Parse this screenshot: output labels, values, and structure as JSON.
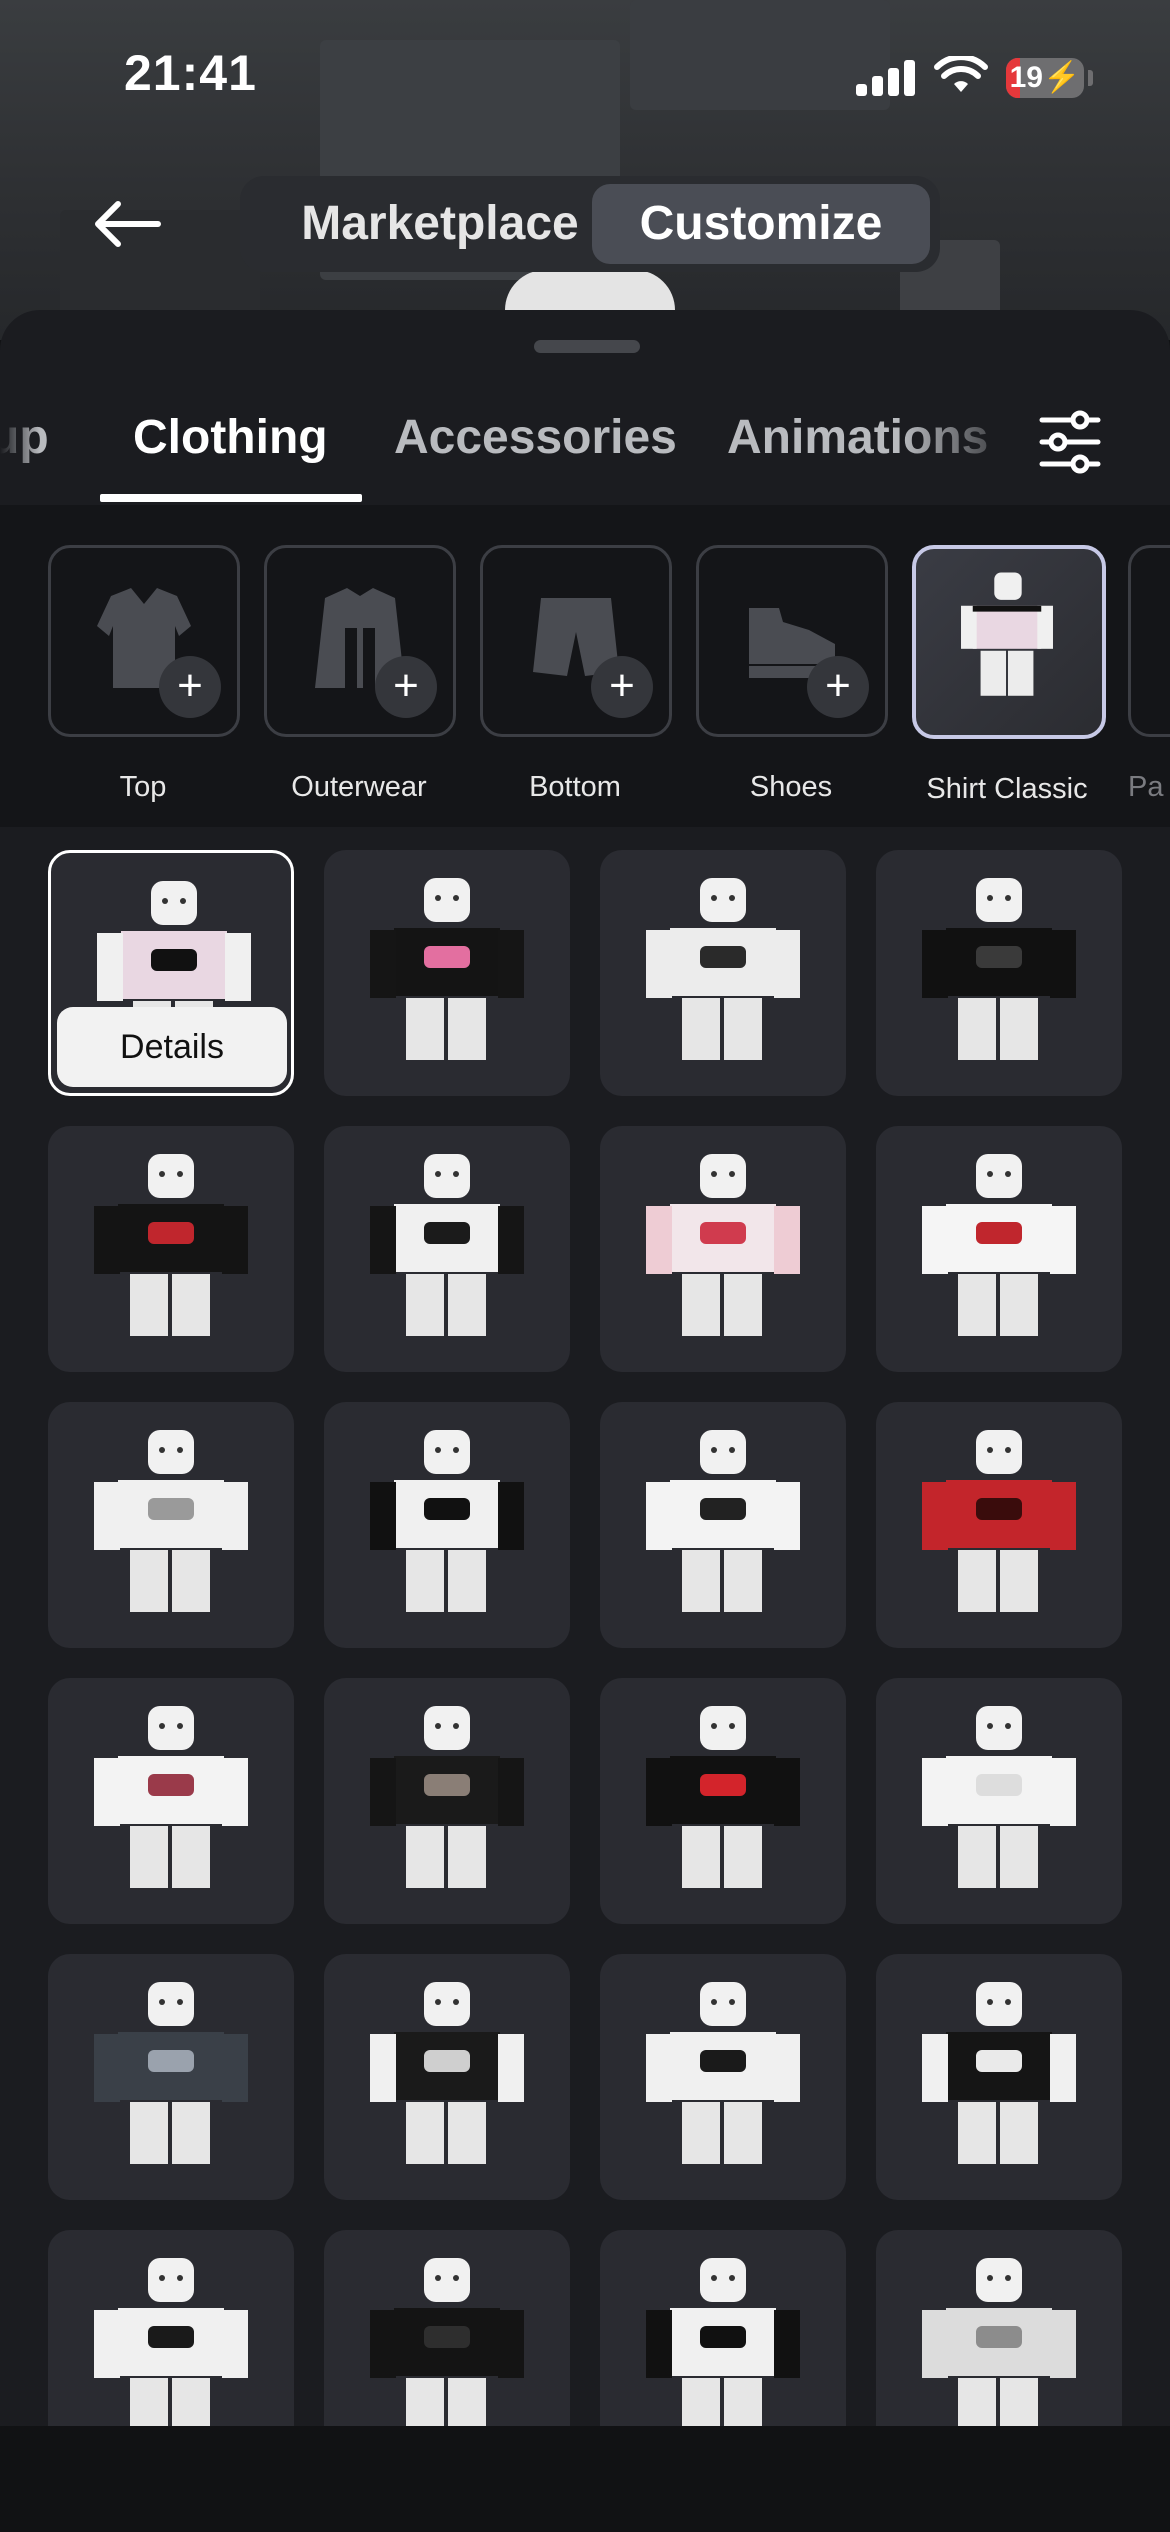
{
  "status": {
    "time": "21:41",
    "battery": "19"
  },
  "segmented": {
    "marketplace": "Marketplace",
    "customize": "Customize"
  },
  "category_tabs": [
    {
      "label": "up"
    },
    {
      "label": "Clothing"
    },
    {
      "label": "Accessories"
    },
    {
      "label": "Animations"
    }
  ],
  "subcategories": [
    {
      "label": "Top",
      "icon": "shirt-icon"
    },
    {
      "label": "Outerwear",
      "icon": "jacket-icon"
    },
    {
      "label": "Bottom",
      "icon": "shorts-icon"
    },
    {
      "label": "Shoes",
      "icon": "shoe-icon"
    },
    {
      "label": "Shirt Classic",
      "icon": "avatar-thumbnail"
    },
    {
      "label": "Pa",
      "icon": "pants-icon"
    }
  ],
  "grid": {
    "details_label": "Details",
    "items": [
      {
        "shirt": "#e9d7e2",
        "accent": "#111111",
        "arms": "#f0f0f0"
      },
      {
        "shirt": "#141414",
        "accent": "#e36fa0",
        "arms": "#151515"
      },
      {
        "shirt": "#ececec",
        "accent": "#2a2a2a",
        "arms": "#ececec"
      },
      {
        "shirt": "#111111",
        "accent": "#3a3a3a",
        "arms": "#111111"
      },
      {
        "shirt": "#141414",
        "accent": "#c0262d",
        "arms": "#141414"
      },
      {
        "shirt": "#f0f0f0",
        "accent": "#1b1b1b",
        "arms": "#151515"
      },
      {
        "shirt": "#f2e6ea",
        "accent": "#d03b4e",
        "arms": "#eeccd4"
      },
      {
        "shirt": "#f5f5f5",
        "accent": "#c0262d",
        "arms": "#f5f5f5"
      },
      {
        "shirt": "#f0f0f0",
        "accent": "#9a9a9a",
        "arms": "#f0f0f0"
      },
      {
        "shirt": "#f0f0f0",
        "accent": "#111111",
        "arms": "#111111"
      },
      {
        "shirt": "#f3f3f3",
        "accent": "#222222",
        "arms": "#f3f3f3"
      },
      {
        "shirt": "#c3252b",
        "accent": "#3a0c0c",
        "arms": "#c3252b"
      },
      {
        "shirt": "#f3f3f3",
        "accent": "#9a3a4a",
        "arms": "#f3f3f3"
      },
      {
        "shirt": "#1a1a1a",
        "accent": "#8a7e76",
        "arms": "#151515"
      },
      {
        "shirt": "#111111",
        "accent": "#d3242b",
        "arms": "#111111"
      },
      {
        "shirt": "#f3f3f3",
        "accent": "#dddddd",
        "arms": "#f3f3f3"
      },
      {
        "shirt": "#3a4048",
        "accent": "#9aa2ad",
        "arms": "#3a4048"
      },
      {
        "shirt": "#1a1a1a",
        "accent": "#cfcfcf",
        "arms": "#f0f0f0"
      },
      {
        "shirt": "#f0f0f0",
        "accent": "#1a1a1a",
        "arms": "#f0f0f0"
      },
      {
        "shirt": "#151515",
        "accent": "#eaeaea",
        "arms": "#f0f0f0"
      },
      {
        "shirt": "#f0f0f0",
        "accent": "#1a1a1a",
        "arms": "#f0f0f0"
      },
      {
        "shirt": "#141414",
        "accent": "#2e2e2e",
        "arms": "#141414"
      },
      {
        "shirt": "#f0f0f0",
        "accent": "#111111",
        "arms": "#111111"
      },
      {
        "shirt": "#dcdcdc",
        "accent": "#8c8c8c",
        "arms": "#dcdcdc"
      }
    ]
  }
}
